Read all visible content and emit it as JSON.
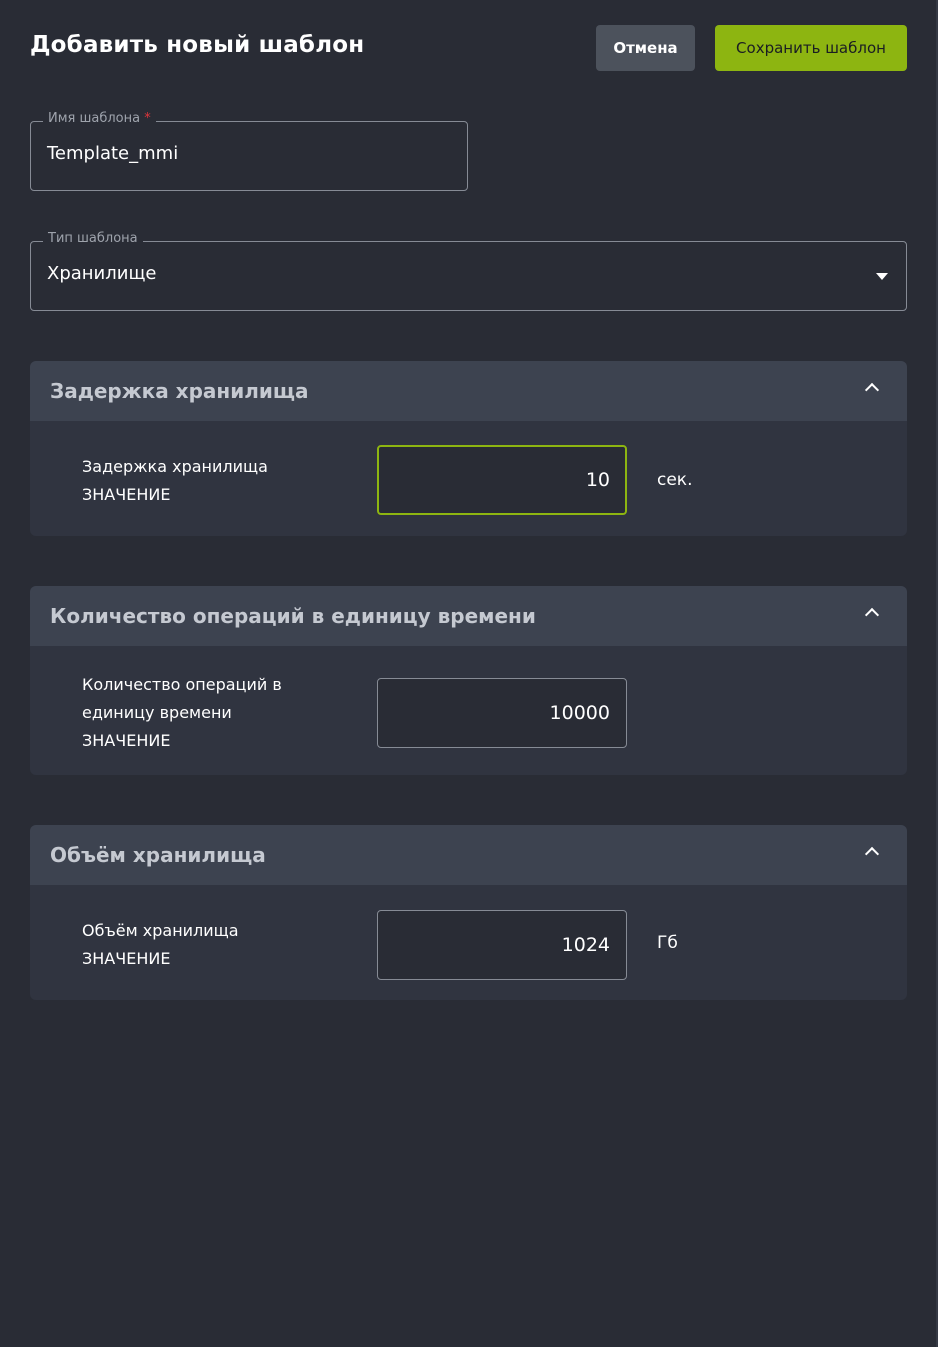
{
  "header": {
    "title": "Добавить новый шаблон",
    "cancel_label": "Отмена",
    "save_label": "Сохранить шаблон"
  },
  "form": {
    "name_field": {
      "label": "Имя шаблона",
      "required_mark": "*",
      "value": "Template_mmi"
    },
    "type_field": {
      "label": "Тип шаблона",
      "value": "Хранилище"
    }
  },
  "sections": [
    {
      "title": "Задержка хранилища",
      "param_label_lines": [
        "Задержка хранилища",
        "ЗНАЧЕНИЕ"
      ],
      "value": "10",
      "unit": "сек."
    },
    {
      "title": "Количество операций в единицу времени",
      "param_label_lines": [
        "Количество операций в",
        "единицу времени",
        "ЗНАЧЕНИЕ"
      ],
      "value": "10000",
      "unit": ""
    },
    {
      "title": "Объём хранилища",
      "param_label_lines": [
        "Объём хранилища",
        "ЗНАЧЕНИЕ"
      ],
      "value": "1024",
      "unit": "Гб"
    }
  ],
  "colors": {
    "background": "#292c35",
    "accent": "#8db511",
    "section_header": "#3d4350",
    "section_body": "#303440",
    "required": "#e0353b"
  },
  "icons": {
    "dropdown": "caret-down-icon",
    "collapse": "chevron-up-icon"
  }
}
